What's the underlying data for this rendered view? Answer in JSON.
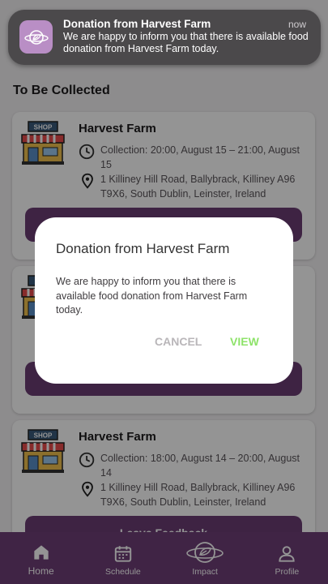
{
  "section_title": "To Be Collected",
  "cards": [
    {
      "name": "Harvest Farm",
      "collection": "Collection: 20:00, August 15 – 21:00, August 15",
      "address": "1 Killiney Hill Road, Ballybrack, Killiney A96 T9X6, South Dublin, Leinster, Ireland",
      "button": ""
    },
    {
      "name": "",
      "collection": "",
      "address": "",
      "button": ""
    },
    {
      "name": "Harvest Farm",
      "collection": "Collection: 18:00, August 14 – 20:00, August 14",
      "address": "1 Killiney Hill Road, Ballybrack, Killiney A96 T9X6, South Dublin, Leinster, Ireland",
      "button": "Leave Feedback"
    }
  ],
  "shop_sign": "SHOP",
  "nav": [
    {
      "label": "Home",
      "icon": "home-icon",
      "active": true
    },
    {
      "label": "Schedule",
      "icon": "calendar-icon",
      "active": false
    },
    {
      "label": "Impact",
      "icon": "planet-leaf-icon",
      "active": false
    },
    {
      "label": "Profile",
      "icon": "person-icon",
      "active": false
    }
  ],
  "dialog": {
    "title": "Donation from Harvest Farm",
    "body": "We are happy to inform you that there is available food donation from Harvest Farm today.",
    "cancel": "CANCEL",
    "view": "VIEW"
  },
  "notification": {
    "title": "Donation from Harvest Farm",
    "time": "now",
    "body": "We are happy to inform you that there is available food donation from Harvest Farm today.",
    "icon": "app-logo-icon"
  },
  "colors": {
    "primary": "#6e3e78",
    "accent_view": "#8ee36a",
    "notification_bg": "#4b494b",
    "app_icon_bg": "#b98ec5"
  }
}
